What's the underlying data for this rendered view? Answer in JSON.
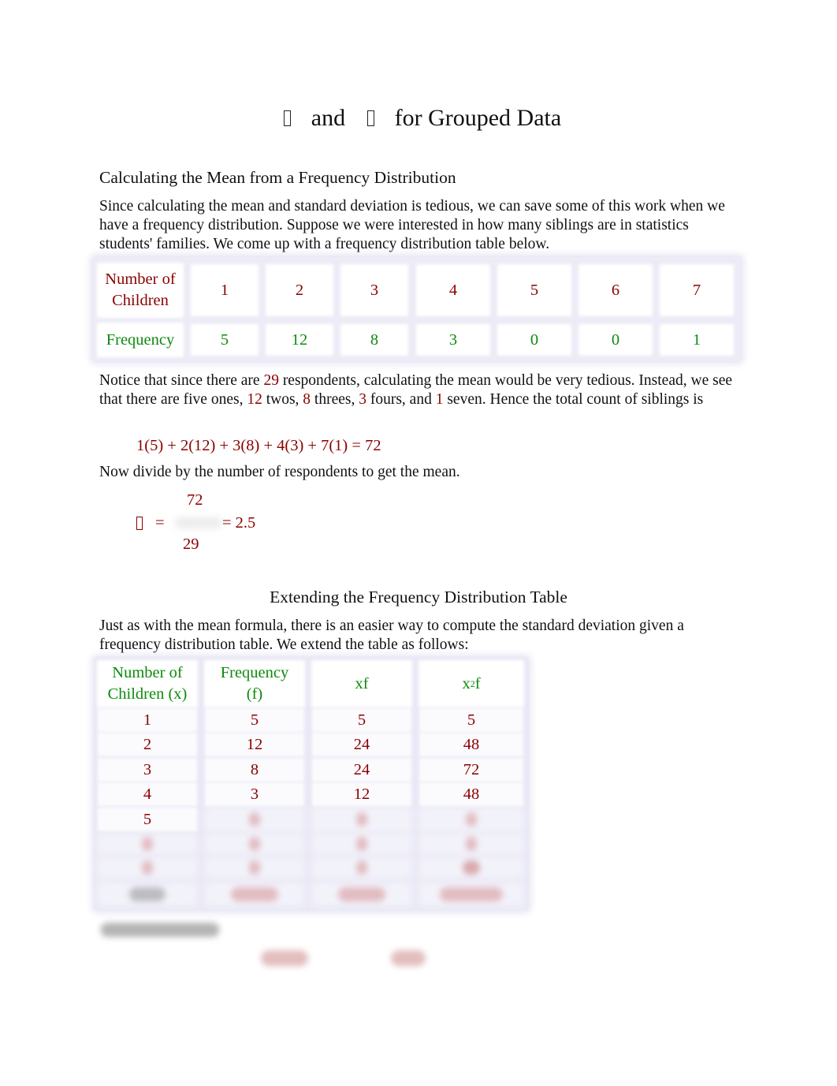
{
  "title": {
    "symbol_1": "missing-glyph",
    "text_1": "and",
    "symbol_2": "missing-glyph",
    "text_2": "for Grouped Data"
  },
  "section1": {
    "heading": "Calculating the Mean from a Frequency Distribution",
    "intro": "Since calculating the mean and standard deviation is tedious, we can save some of this work when we have a frequency distribution. Suppose we were interested in how many siblings are in statistics students' families. We come up with a frequency distribution table below.",
    "table": {
      "row_header_1": "Number of Children",
      "row_header_2": "Frequency",
      "children": [
        "1",
        "2",
        "3",
        "4",
        "5",
        "6",
        "7"
      ],
      "frequency": [
        "5",
        "12",
        "8",
        "3",
        "0",
        "0",
        "1"
      ]
    },
    "notice": {
      "part1": "Notice that since there are ",
      "n": "29",
      "part2": " respondents, calculating the mean would be very tedious. Instead, we see that there are five ones, ",
      "v12": "12",
      "part3": " twos, ",
      "v8": "8",
      "part4": " threes, ",
      "v3": "3",
      "part5": " fours, and ",
      "v1": "1",
      "part6": " seven. Hence the total count of siblings is"
    },
    "sum_formula": "1(5) + 2(12) + 3(8) + 4(3) + 7(1) = 72",
    "divide_text": "Now divide by the number of respondents to get the mean.",
    "mean": {
      "symbol": "missing-glyph",
      "equals": "=",
      "numerator": "72",
      "denominator": "29",
      "result": "= 2.5"
    }
  },
  "section2": {
    "heading": "Extending the Frequency Distribution Table",
    "intro": "Just as with the mean formula, there is an easier way to compute the standard deviation given a frequency distribution table. We extend the table as follows:",
    "table": {
      "headers": [
        {
          "line1": "Number of",
          "line2": "Children (x)"
        },
        {
          "line1": "Frequency",
          "line2": "(f)"
        },
        {
          "line1": "xf",
          "line2": ""
        },
        {
          "line1": "x",
          "sup": "2",
          "line1_after": "f"
        }
      ],
      "rows": [
        [
          "1",
          "5",
          "5",
          "5"
        ],
        [
          "2",
          "12",
          "24",
          "48"
        ],
        [
          "3",
          "8",
          "24",
          "72"
        ],
        [
          "4",
          "3",
          "12",
          "48"
        ],
        [
          "5",
          "",
          "",
          ""
        ]
      ],
      "blurred_rows": 3
    },
    "blurred_paragraph": true
  },
  "colors": {
    "text": "#111111",
    "accent_red": "#8b0000",
    "accent_green": "#0d8a0d",
    "table_grid": "#e9e8f5"
  }
}
